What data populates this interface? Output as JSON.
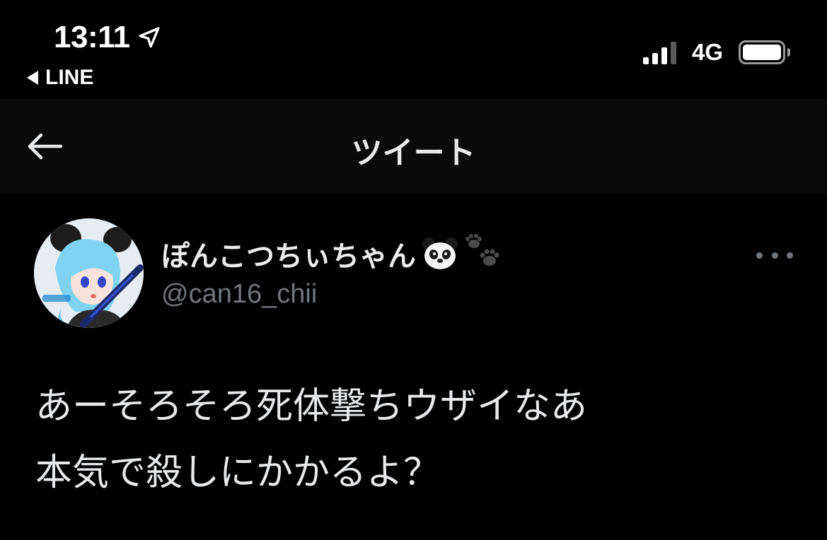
{
  "status_bar": {
    "time": "13:11",
    "back_app": "LINE",
    "network": "4G",
    "signal_bars_filled": 3,
    "signal_bars_total": 4,
    "battery_level": 1.0
  },
  "header": {
    "title": "ツイート"
  },
  "tweet": {
    "display_name": "ぽんこつちぃちゃん",
    "display_name_emojis": [
      "panda-face",
      "paw-prints"
    ],
    "handle": "@can16_chii",
    "text_lines": [
      "あーそろそろ死体撃ちウザイなあ",
      "本気で殺しにかかるよ？"
    ]
  },
  "colors": {
    "background": "#000000",
    "header_background": "#0a0a0a",
    "primary_text": "#e7e9ea",
    "secondary_text": "#71767b"
  }
}
